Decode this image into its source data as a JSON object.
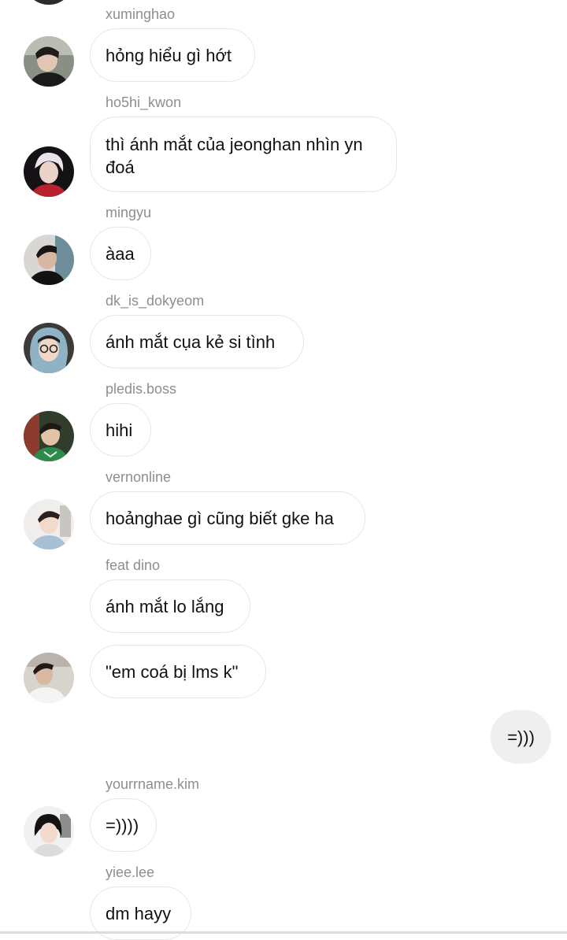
{
  "messages": [
    {
      "username": "xuminghao",
      "text": "hỏng hiểu gì hớt",
      "avatar_icon": "profile-photo-icon"
    },
    {
      "username": "ho5hi_kwon",
      "text": "thì ánh mắt của jeonghan nhìn yn đoá",
      "avatar_icon": "profile-photo-icon"
    },
    {
      "username": "mingyu",
      "text": "àaa",
      "avatar_icon": "profile-photo-icon"
    },
    {
      "username": "dk_is_dokyeom",
      "text": "ánh mắt cụa kẻ si tình",
      "avatar_icon": "profile-photo-icon"
    },
    {
      "username": "pledis.boss",
      "text": "hihi",
      "avatar_icon": "profile-photo-icon"
    },
    {
      "username": "vernonline",
      "text": "hoảnghae gì cũng biết gke ha",
      "avatar_icon": "profile-photo-icon"
    },
    {
      "username": "feat dino",
      "text": "ánh mắt lo lắng",
      "avatar_icon": "profile-photo-icon"
    },
    {
      "username": "",
      "text": "\"em coá bị lms k\"",
      "avatar_icon": "profile-photo-icon"
    },
    {
      "username": "",
      "text": "=)))",
      "sent": true
    },
    {
      "username": "yourrname.kim",
      "text": "=))))",
      "avatar_icon": "profile-photo-icon"
    },
    {
      "username": "yiee.lee",
      "text": "dm hayy",
      "avatar_icon": "profile-photo-icon"
    }
  ],
  "colors": {
    "background": "#ffffff",
    "username": "#8e8e8e",
    "bubble_border": "#e6e6e6",
    "sent_bubble": "#efefef",
    "text": "#111111"
  }
}
